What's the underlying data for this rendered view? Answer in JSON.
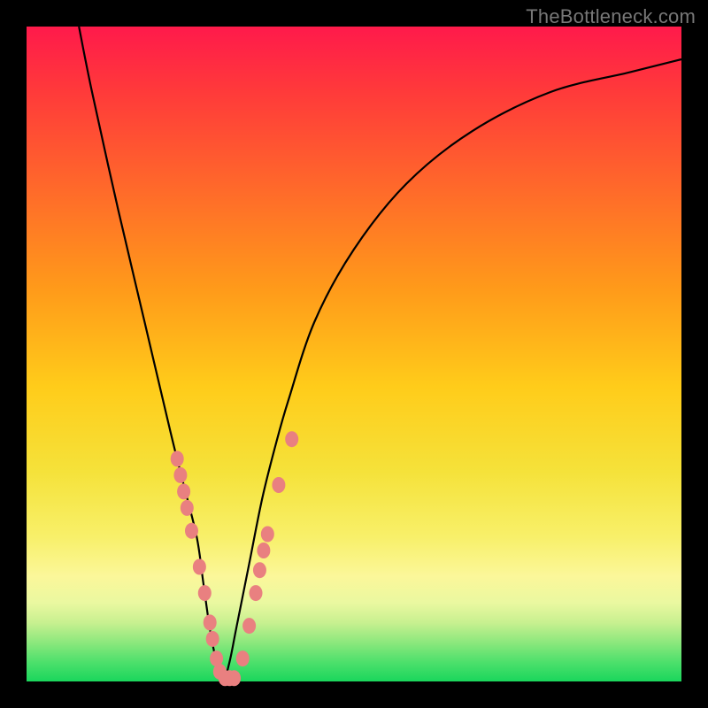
{
  "watermark": "TheBottleneck.com",
  "chart_data": {
    "type": "line",
    "title": "",
    "xlabel": "",
    "ylabel": "",
    "xlim": [
      0,
      100
    ],
    "ylim": [
      0,
      100
    ],
    "series": [
      {
        "name": "curve",
        "x": [
          8,
          10,
          14,
          18,
          22,
          24,
          26,
          27,
          28,
          29,
          30,
          31,
          32,
          34,
          36,
          38,
          40,
          44,
          50,
          58,
          68,
          80,
          92,
          100
        ],
        "y": [
          100,
          90,
          72,
          55,
          38,
          30,
          22,
          15,
          8,
          3,
          0,
          3,
          8,
          18,
          28,
          36,
          43,
          55,
          66,
          76,
          84,
          90,
          93,
          95
        ]
      }
    ],
    "markers": [
      {
        "x": 23.0,
        "y": 34.0
      },
      {
        "x": 23.5,
        "y": 31.5
      },
      {
        "x": 24.0,
        "y": 29.0
      },
      {
        "x": 24.5,
        "y": 26.5
      },
      {
        "x": 25.2,
        "y": 23.0
      },
      {
        "x": 26.4,
        "y": 17.5
      },
      {
        "x": 27.2,
        "y": 13.5
      },
      {
        "x": 28.0,
        "y": 9.0
      },
      {
        "x": 28.4,
        "y": 6.5
      },
      {
        "x": 29.0,
        "y": 3.5
      },
      {
        "x": 29.5,
        "y": 1.5
      },
      {
        "x": 30.3,
        "y": 0.5
      },
      {
        "x": 31.0,
        "y": 0.5
      },
      {
        "x": 31.7,
        "y": 0.5
      },
      {
        "x": 33.0,
        "y": 3.5
      },
      {
        "x": 34.0,
        "y": 8.5
      },
      {
        "x": 35.0,
        "y": 13.5
      },
      {
        "x": 35.6,
        "y": 17.0
      },
      {
        "x": 36.2,
        "y": 20.0
      },
      {
        "x": 36.8,
        "y": 22.5
      },
      {
        "x": 38.5,
        "y": 30.0
      },
      {
        "x": 40.5,
        "y": 37.0
      }
    ],
    "colors": {
      "curve": "#000000",
      "marker_fill": "#e98080",
      "marker_stroke": "#b85a5a",
      "gradient_top": "#ff1a4b",
      "gradient_bottom": "#1ad65c"
    }
  }
}
